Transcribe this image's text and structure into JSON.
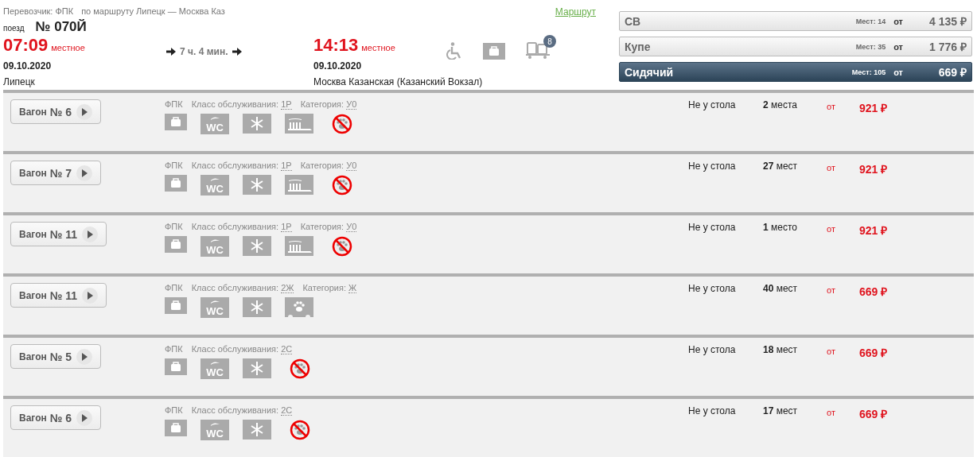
{
  "header": {
    "carrier": "Перевозчик: ФПК",
    "route": "по маршруту Липецк — Москва Каз",
    "route_link": "Маршрут",
    "train_label": "поезд",
    "train_number": "№ 070Й",
    "departure": {
      "time": "07:09",
      "time_note": "местное",
      "date": "09.10.2020",
      "station": "Липецк"
    },
    "duration": "7 ч. 4 мин.",
    "arrival": {
      "time": "14:13",
      "time_note": "местное",
      "date": "09.10.2020",
      "station": "Москва Казанская (Казанский Вокзал)"
    },
    "luggage_badge": "8"
  },
  "classes": [
    {
      "name": "СВ",
      "seats": "Мест: 14",
      "from": "от",
      "price": "4 135 ₽",
      "selected": false
    },
    {
      "name": "Купе",
      "seats": "Мест: 35",
      "from": "от",
      "price": "1 776 ₽",
      "selected": false
    },
    {
      "name": "Сидячий",
      "seats": "Мест: 105",
      "from": "от",
      "price": "669 ₽",
      "selected": true
    }
  ],
  "cars": [
    {
      "button": "Вагон",
      "number": "№ 6",
      "carrier": "ФПК",
      "class_label": "Класс обслуживания:",
      "class_value": "1Р",
      "category_label": "Категория:",
      "category_value": "У0",
      "amenities": [
        {
          "kind": "bag"
        },
        {
          "kind": "wc",
          "label": "WC"
        },
        {
          "kind": "snow"
        },
        {
          "kind": "brush"
        },
        {
          "kind": "nopets"
        }
      ],
      "place": "Не у стола",
      "seats": "**2** места",
      "from": "от",
      "price": "921 ₽"
    },
    {
      "button": "Вагон",
      "number": "№ 7",
      "carrier": "ФПК",
      "class_label": "Класс обслуживания:",
      "class_value": "1Р",
      "category_label": "Категория:",
      "category_value": "У0",
      "amenities": [
        {
          "kind": "bag"
        },
        {
          "kind": "wc",
          "label": "WC"
        },
        {
          "kind": "snow"
        },
        {
          "kind": "brush"
        },
        {
          "kind": "nopets"
        }
      ],
      "place": "Не у стола",
      "seats": "**27** мест",
      "from": "от",
      "price": "921 ₽"
    },
    {
      "button": "Вагон",
      "number": "№ 11",
      "carrier": "ФПК",
      "class_label": "Класс обслуживания:",
      "class_value": "1Р",
      "category_label": "Категория:",
      "category_value": "У0",
      "amenities": [
        {
          "kind": "bag"
        },
        {
          "kind": "wc",
          "label": "WC"
        },
        {
          "kind": "snow"
        },
        {
          "kind": "brush"
        },
        {
          "kind": "nopets"
        }
      ],
      "place": "Не у стола",
      "seats": "**1** место",
      "from": "от",
      "price": "921 ₽"
    },
    {
      "button": "Вагон",
      "number": "№ 11",
      "carrier": "ФПК",
      "class_label": "Класс обслуживания:",
      "class_value": "2Ж",
      "category_label": "Категория:",
      "category_value": "Ж",
      "amenities": [
        {
          "kind": "bag"
        },
        {
          "kind": "wc",
          "label": "WC"
        },
        {
          "kind": "snow"
        },
        {
          "kind": "pets"
        }
      ],
      "place": "Не у стола",
      "seats": "**40** мест",
      "from": "от",
      "price": "669 ₽"
    },
    {
      "button": "Вагон",
      "number": "№ 5",
      "carrier": "ФПК",
      "class_label": "Класс обслуживания:",
      "class_value": "2С",
      "amenities": [
        {
          "kind": "bag"
        },
        {
          "kind": "wc",
          "label": "WC"
        },
        {
          "kind": "snow"
        },
        {
          "kind": "nopets"
        }
      ],
      "place": "Не у стола",
      "seats": "**18** мест",
      "from": "от",
      "price": "669 ₽"
    },
    {
      "button": "Вагон",
      "number": "№ 6",
      "carrier": "ФПК",
      "class_label": "Класс обслуживания:",
      "class_value": "2С",
      "amenities": [
        {
          "kind": "bag"
        },
        {
          "kind": "wc",
          "label": "WC"
        },
        {
          "kind": "snow"
        },
        {
          "kind": "nopets"
        }
      ],
      "place": "Не у стола",
      "seats": "**17** мест",
      "from": "от",
      "price": "669 ₽"
    }
  ]
}
